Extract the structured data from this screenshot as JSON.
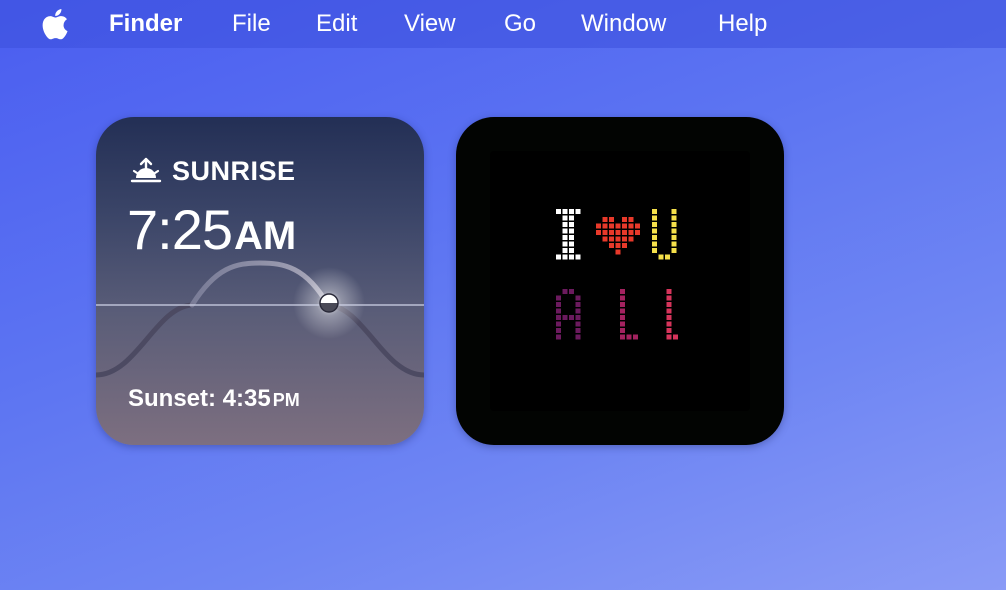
{
  "menubar": {
    "app_name": "Finder",
    "items": [
      "File",
      "Edit",
      "View",
      "Go",
      "Window",
      "Help"
    ]
  },
  "icons": {
    "apple": "apple-logo-icon",
    "sunrise": "sunrise-icon"
  },
  "sunrise_widget": {
    "label": "SUNRISE",
    "time": "7:25",
    "time_suffix": "AM",
    "sunset_label": "Sunset: 4:35",
    "sunset_suffix": "PM"
  },
  "pixel_widget": {
    "line1": "I♥U",
    "line2": "ALL",
    "colors": {
      "i": "#ffffff",
      "heart": "#e8392a",
      "u": "#f5e04a",
      "a": "#6b1a5e",
      "l1": "#a3225f",
      "l2": "#d6345b"
    }
  }
}
